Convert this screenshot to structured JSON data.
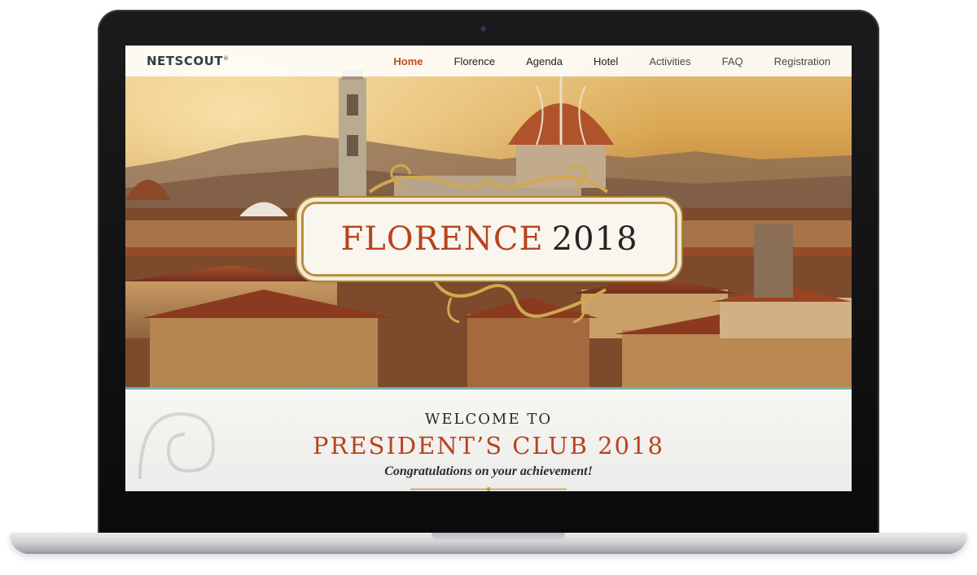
{
  "nav": {
    "logo": "NETSCOUT",
    "logo_tm": "®",
    "items": [
      {
        "label": "Home",
        "active": true
      },
      {
        "label": "Florence",
        "active": false
      },
      {
        "label": "Agenda",
        "active": false
      },
      {
        "label": "Hotel",
        "active": false
      },
      {
        "label": "Activities",
        "active": false
      },
      {
        "label": "FAQ",
        "active": false
      },
      {
        "label": "Registration",
        "active": false
      }
    ]
  },
  "hero": {
    "city": "FLORENCE",
    "year": "2018"
  },
  "welcome": {
    "line1": "WELCOME TO",
    "line2": "PRESIDENT’S CLUB 2018",
    "line3": "Congratulations on your achievement!"
  },
  "colors": {
    "accent": "#b8431d",
    "teal": "#6fb4b1",
    "gold": "#b8903f"
  }
}
